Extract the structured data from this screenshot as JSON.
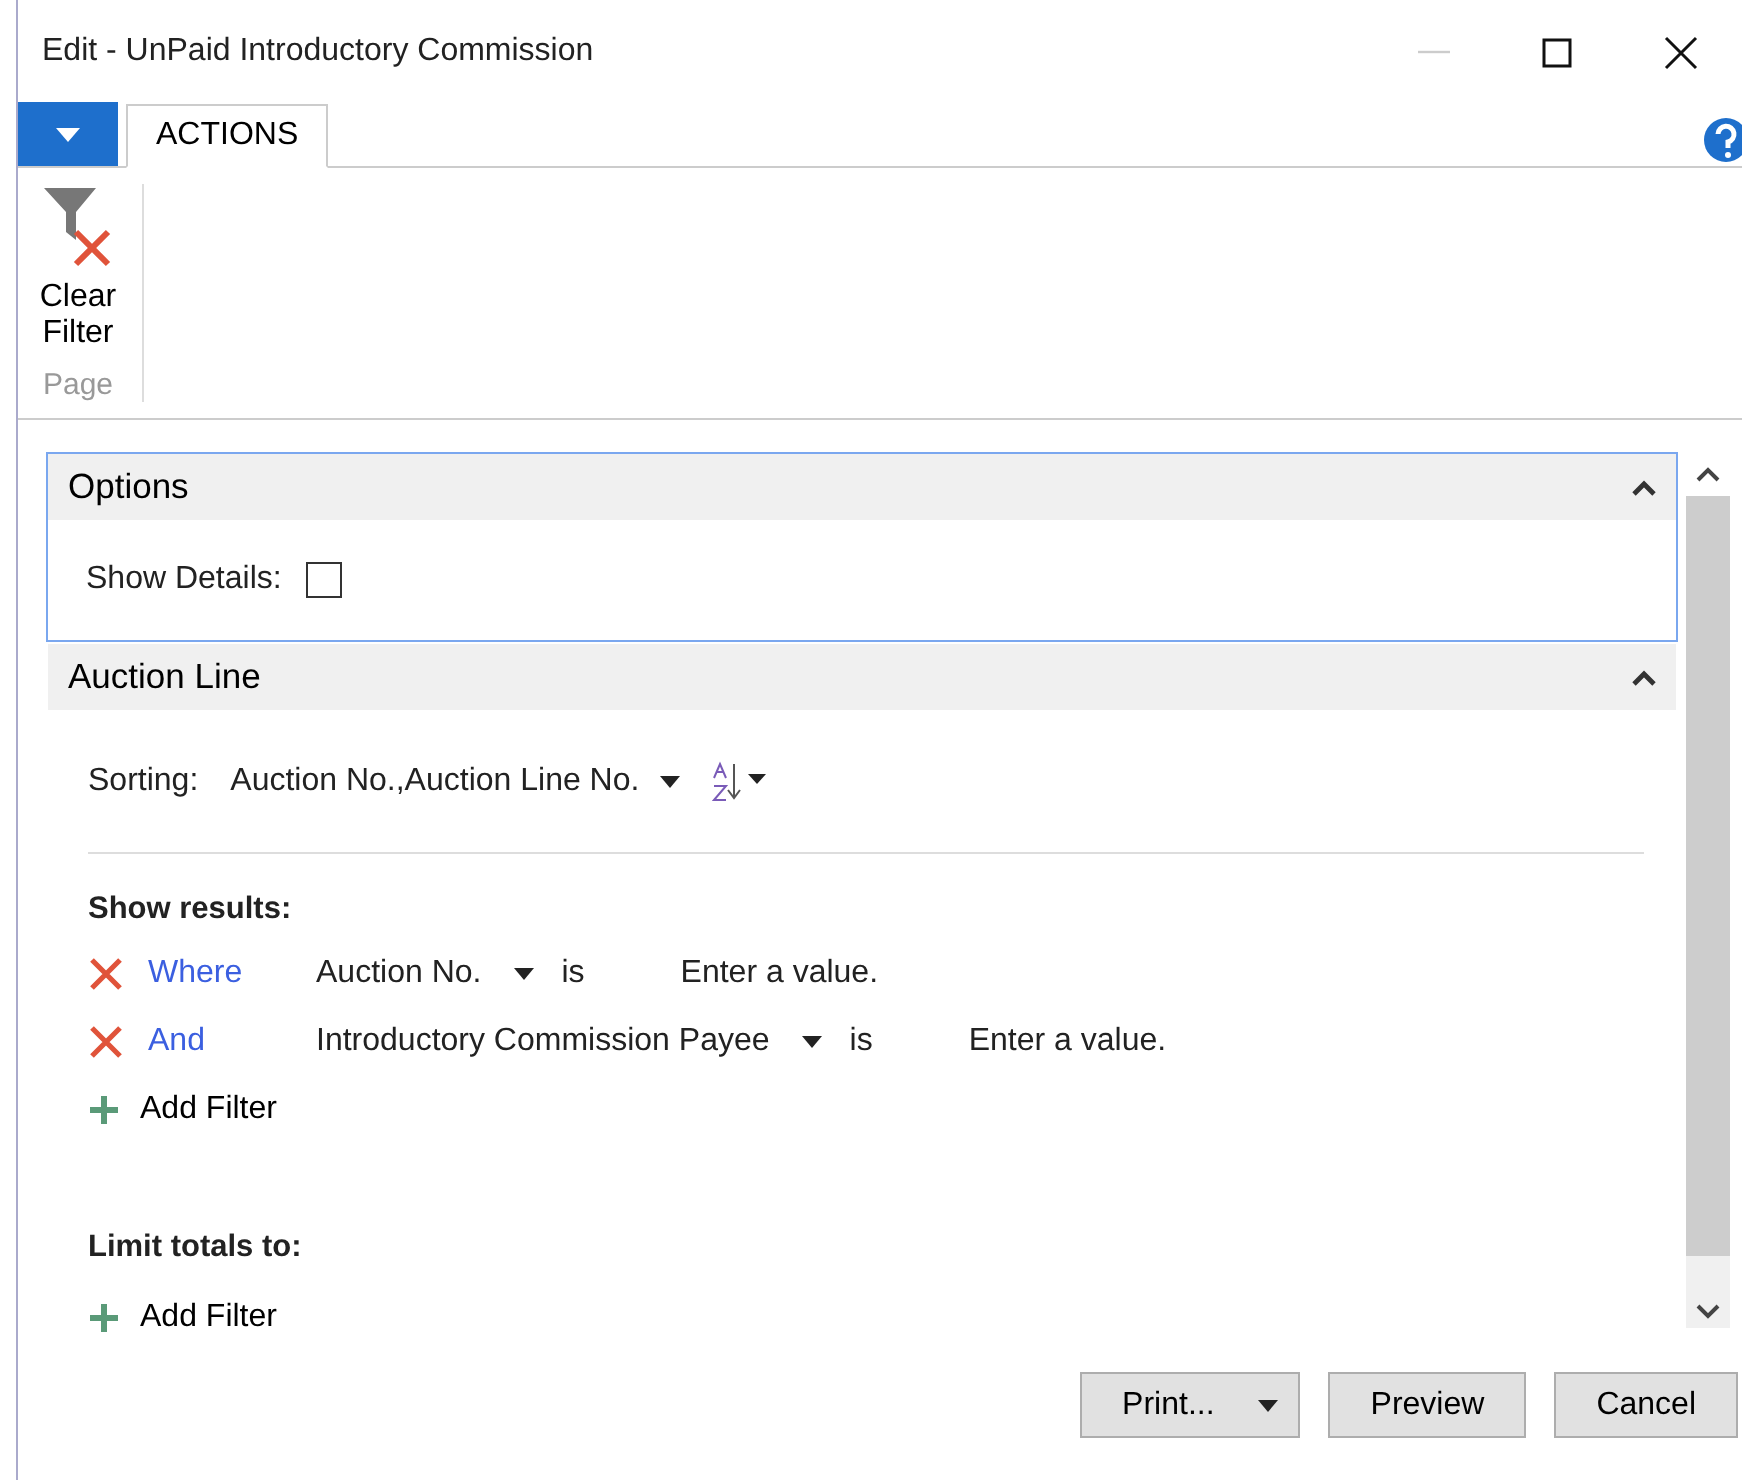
{
  "window": {
    "title": "Edit - UnPaid Introductory Commission"
  },
  "tabs": [
    {
      "label": "ACTIONS",
      "selected": true
    }
  ],
  "ribbon": {
    "actions": [
      {
        "label": "Clear Filter"
      }
    ],
    "group": "Page"
  },
  "options": {
    "title": "Options",
    "expanded": true,
    "focused": true,
    "show_details": {
      "label": "Show Details:",
      "checked": false
    }
  },
  "auction_line": {
    "title": "Auction Line",
    "expanded": true,
    "focused": false,
    "sorting": {
      "label": "Sorting:",
      "value": "Auction No.,Auction Line No."
    },
    "show_results": {
      "heading": "Show results:",
      "filters": [
        {
          "connector": "Where",
          "field": "Auction No.",
          "operator": "is",
          "value": "Enter a value."
        },
        {
          "connector": "And",
          "field": "Introductory Commission Payee",
          "operator": "is",
          "value": "Enter a value."
        }
      ],
      "add": "Add Filter"
    },
    "limit_totals": {
      "heading": "Limit totals to:",
      "add": "Add Filter"
    }
  },
  "buttons": [
    {
      "label": "Print...",
      "kind": "dropdown"
    },
    {
      "label": "Preview",
      "kind": "plain"
    },
    {
      "label": "Cancel",
      "kind": "plain"
    }
  ]
}
